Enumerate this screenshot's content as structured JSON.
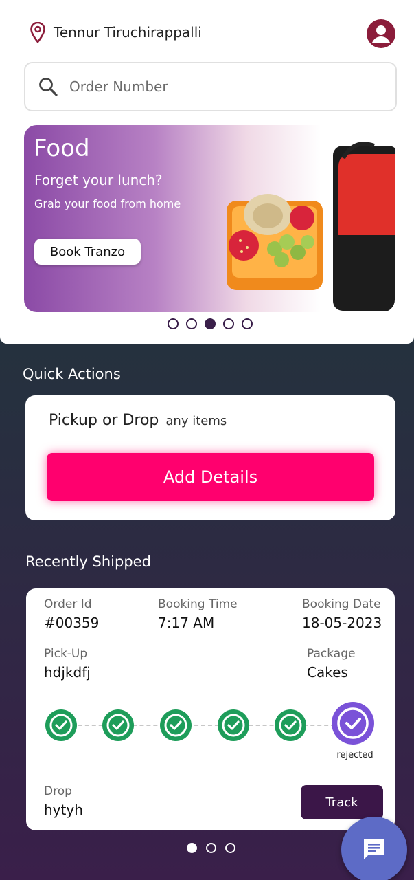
{
  "header": {
    "location": "Tennur Tiruchirappalli",
    "location_icon": "location-pin-icon",
    "avatar_icon": "user-avatar-icon"
  },
  "search": {
    "placeholder": "Order Number",
    "icon": "search-icon"
  },
  "banner": {
    "title": "Food",
    "subtitle": "Forget your lunch?",
    "tagline": "Grab your food from home",
    "button_label": "Book Tranzo",
    "image": "lunchbox-illustration"
  },
  "carousel": {
    "total": 5,
    "active_index": 2
  },
  "quick_actions": {
    "title": "Quick Actions",
    "prompt_strong": "Pickup or Drop",
    "prompt_light": "any items",
    "button_label": "Add Details"
  },
  "recently_shipped": {
    "title": "Recently Shipped",
    "order_id_label": "Order Id",
    "order_id": "#00359",
    "booking_time_label": "Booking Time",
    "booking_time": "7:17 AM",
    "booking_date_label": "Booking Date",
    "booking_date": "18-05-2023",
    "pickup_label": "Pick-Up",
    "pickup": "hdjkdfj",
    "package_label": "Package",
    "package": "Cakes",
    "drop_label": "Drop",
    "drop": "hytyh",
    "status_label": "rejected",
    "track_label": "Track",
    "steps_completed": 5,
    "steps_total": 6
  },
  "pager": {
    "total": 3,
    "active_index": 0
  },
  "fab": {
    "icon": "chat-icon"
  },
  "colors": {
    "primary_pink": "#ff006e",
    "dark_purple": "#3b1648",
    "accent_red": "#8b1c3a",
    "step_green": "#1e9d5a",
    "step_purple": "#7a52d8",
    "fab_blue": "#5d6bc6"
  }
}
